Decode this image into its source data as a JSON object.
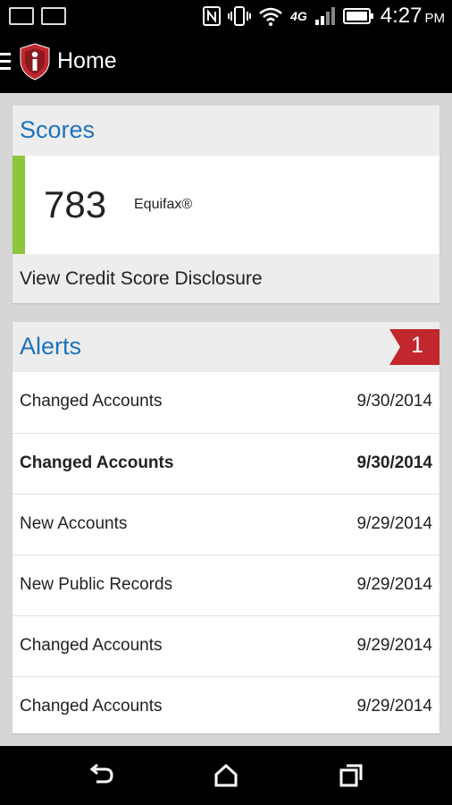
{
  "status_bar": {
    "time": "4:27",
    "ampm": "PM",
    "network": "4G"
  },
  "app_bar": {
    "title": "Home"
  },
  "scores": {
    "title": "Scores",
    "value": "783",
    "provider": "Equifax®",
    "disclosure": "View Credit Score Disclosure",
    "accent_color": "#8cc63f"
  },
  "alerts": {
    "title": "Alerts",
    "badge": "1",
    "items": [
      {
        "name": "Changed Accounts",
        "date": "9/30/2014"
      },
      {
        "name": "Changed Accounts",
        "date": "9/30/2014"
      },
      {
        "name": "New Accounts",
        "date": "9/29/2014"
      },
      {
        "name": "New Public Records",
        "date": "9/29/2014"
      },
      {
        "name": "Changed Accounts",
        "date": "9/29/2014"
      },
      {
        "name": "Changed Accounts",
        "date": "9/29/2014"
      }
    ]
  }
}
